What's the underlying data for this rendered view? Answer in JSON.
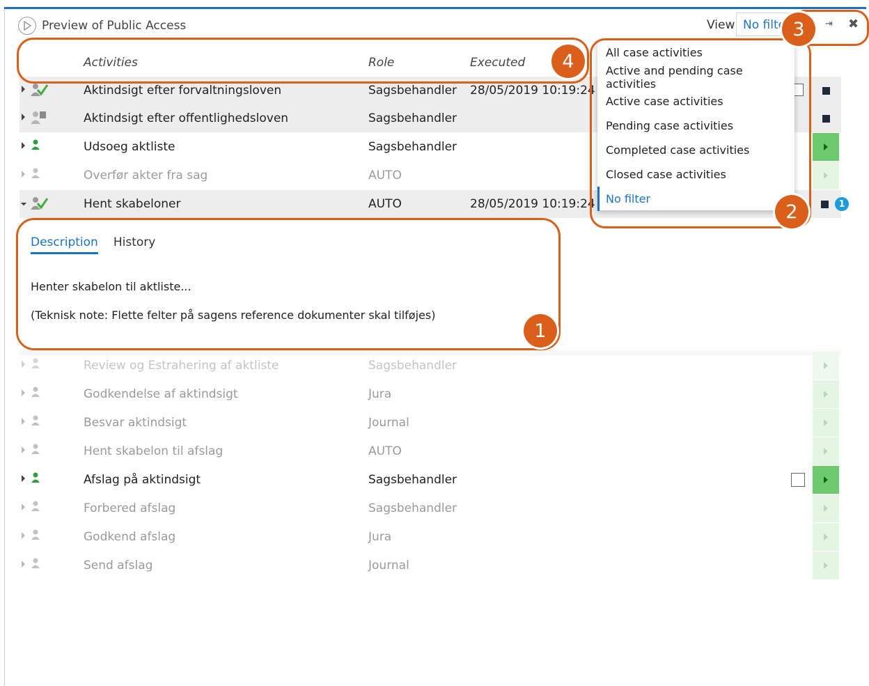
{
  "header": {
    "title": "Preview of Public Access",
    "view_label": "View",
    "view_value": "No filter"
  },
  "columns": {
    "activities": "Activities",
    "role": "Role",
    "executed": "Executed"
  },
  "rows_top": [
    {
      "name": "Aktindsigt efter forvaltningsloven",
      "role": "Sagsbehandler",
      "executed": "28/05/2019 10:19:24"
    },
    {
      "name": "Aktindsigt efter offentlighedsloven",
      "role": "Sagsbehandler",
      "executed": ""
    },
    {
      "name": "Udsoeg aktliste",
      "role": "Sagsbehandler",
      "executed": ""
    },
    {
      "name": "Overfør akter fra sag",
      "role": "AUTO",
      "executed": ""
    },
    {
      "name": "Hent skabeloner",
      "role": "AUTO",
      "executed": "28/05/2019 10:19:24",
      "badge": "1"
    }
  ],
  "dropdown": {
    "options": [
      "All case activities",
      "Active and pending case activities",
      "Active case activities",
      "Pending case activities",
      "Completed case activities",
      "Closed case activities",
      "No filter"
    ]
  },
  "detail": {
    "tab_description": "Description",
    "tab_history": "History",
    "line1": "Henter skabelon til aktliste...",
    "line2": "(Teknisk note: Flette felter på sagens reference dokumenter skal tilføjes)"
  },
  "rows_bottom": [
    {
      "name": "Review og Estrahering af aktliste",
      "role": "Sagsbehandler"
    },
    {
      "name": "Godkendelse af aktindsigt",
      "role": "Jura"
    },
    {
      "name": "Besvar aktindsigt",
      "role": "Journal"
    },
    {
      "name": "Hent skabelon til afslag",
      "role": "AUTO"
    },
    {
      "name": "Afslag på aktindsigt",
      "role": "Sagsbehandler"
    },
    {
      "name": "Forbered afslag",
      "role": "Sagsbehandler"
    },
    {
      "name": "Godkend afslag",
      "role": "Jura"
    },
    {
      "name": "Send afslag",
      "role": "Journal"
    }
  ],
  "annotations": [
    "1",
    "2",
    "3",
    "4"
  ],
  "colors": {
    "accent": "#1a73c9",
    "annotation": "#d95f1a",
    "run_green": "#6dcb6d",
    "done_green": "#3fae3f"
  }
}
